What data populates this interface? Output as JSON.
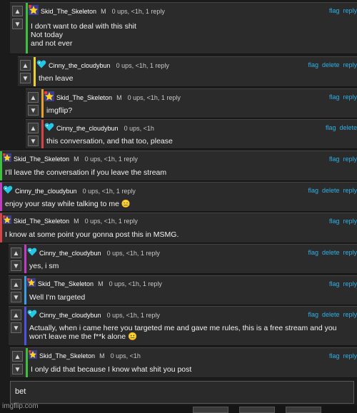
{
  "colors": {
    "link": "#2fb0e8",
    "bars": [
      "#3fbf3f",
      "#e8d12f",
      "#e3a32a",
      "#d64545",
      "#c03cc0",
      "#3a9fe0",
      "#5151e0"
    ]
  },
  "icons": {
    "upvote": "arrow-up-icon",
    "downvote": "arrow-down-icon",
    "skid_avatar": "star-avatar-icon",
    "cinny_avatar": "heart-avatar-icon"
  },
  "comments": [
    {
      "user": "Skid_The_Skeleton",
      "mod": "M",
      "meta": "0 ups, <1h, 1 reply",
      "actions": [
        "flag",
        "reply"
      ],
      "text": "I don't want to deal with this shit\nNot today\nand not ever"
    },
    {
      "user": "Cinny_the_cloudybun",
      "mod": "",
      "meta": "0 ups, <1h, 1 reply",
      "actions": [
        "flag",
        "delete",
        "reply"
      ],
      "text": "then leave"
    },
    {
      "user": "Skid_The_Skeleton",
      "mod": "M",
      "meta": "0 ups, <1h, 1 reply",
      "actions": [
        "flag",
        "reply"
      ],
      "text": "imgflip?"
    },
    {
      "user": "Cinny_the_cloudybun",
      "mod": "",
      "meta": "0 ups, <1h",
      "actions": [
        "flag",
        "delete"
      ],
      "text": "this conversation, and that too, please"
    },
    {
      "user": "Skid_The_Skeleton",
      "mod": "M",
      "meta": "0 ups, <1h, 1 reply",
      "actions": [
        "flag",
        "reply"
      ],
      "text": "I'll leave the conversation if you leave the stream"
    },
    {
      "user": "Cinny_the_cloudybun",
      "mod": "",
      "meta": "0 ups, <1h, 1 reply",
      "actions": [
        "flag",
        "delete",
        "reply"
      ],
      "text": "enjoy your stay while talking to me 😑"
    },
    {
      "user": "Skid_The_Skeleton",
      "mod": "M",
      "meta": "0 ups, <1h, 1 reply",
      "actions": [
        "flag",
        "reply"
      ],
      "text": "I know at some point your gonna post this in MSMG."
    },
    {
      "user": "Cinny_the_cloudybun",
      "mod": "",
      "meta": "0 ups, <1h, 1 reply",
      "actions": [
        "flag",
        "delete",
        "reply"
      ],
      "text": "yes, i sm"
    },
    {
      "user": "Skid_The_Skeleton",
      "mod": "M",
      "meta": "0 ups, <1h, 1 reply",
      "actions": [
        "flag",
        "reply"
      ],
      "text": "Well I'm targeted"
    },
    {
      "user": "Cinny_the_cloudybun",
      "mod": "",
      "meta": "0 ups, <1h, 1 reply",
      "actions": [
        "flag",
        "delete",
        "reply"
      ],
      "text": "Actually, when i came here you targeted me and gave me rules, this is a free stream and you won't leave me the f**k alone 😐"
    },
    {
      "user": "Skid_The_Skeleton",
      "mod": "M",
      "meta": "0 ups, <1h",
      "actions": [
        "flag",
        "reply"
      ],
      "text": "I only did that because I know what shit you post"
    }
  ],
  "reply_box": {
    "value": "bet"
  },
  "watermark": "imgflip.com"
}
